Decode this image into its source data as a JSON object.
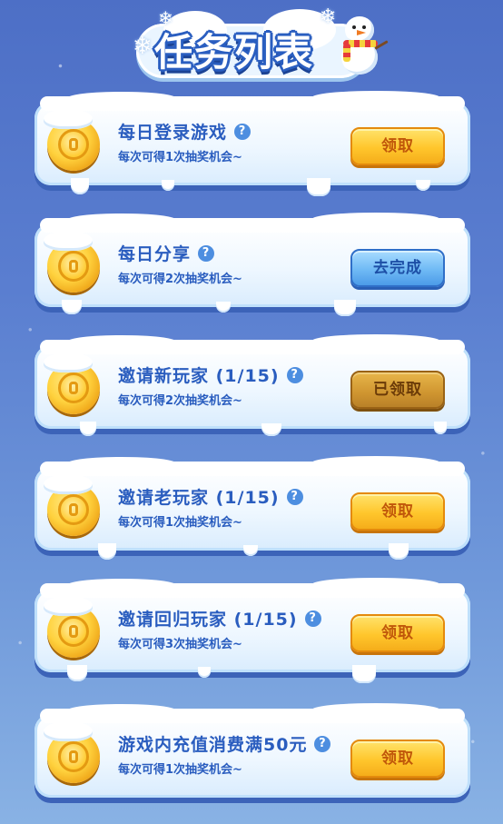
{
  "header": {
    "title": "任务列表",
    "decor_icons": [
      "snowflake-icon",
      "snowman-icon"
    ]
  },
  "tasks": [
    {
      "title": "每日登录游戏",
      "reward": "每次可得1次抽奖机会~",
      "button": "领取",
      "state": "claim"
    },
    {
      "title": "每日分享",
      "reward": "每次可得2次抽奖机会~",
      "button": "去完成",
      "state": "go"
    },
    {
      "title": "邀请新玩家 (1/15)",
      "reward": "每次可得2次抽奖机会~",
      "button": "已领取",
      "state": "claimed"
    },
    {
      "title": "邀请老玩家 (1/15)",
      "reward": "每次可得1次抽奖机会~",
      "button": "领取",
      "state": "claim"
    },
    {
      "title": "邀请回归玩家 (1/15)",
      "reward": "每次可得3次抽奖机会~",
      "button": "领取",
      "state": "claim"
    },
    {
      "title": "游戏内充值消费满50元",
      "reward": "每次可得1次抽奖机会~",
      "button": "领取",
      "state": "claim"
    }
  ],
  "help_icon": "?",
  "colors": {
    "background_top": "#4d6fc6",
    "card_text": "#2a5dbf",
    "claim_button": "#ffc62c",
    "go_button": "#6fbaf5",
    "claimed_button": "#cf9530"
  }
}
